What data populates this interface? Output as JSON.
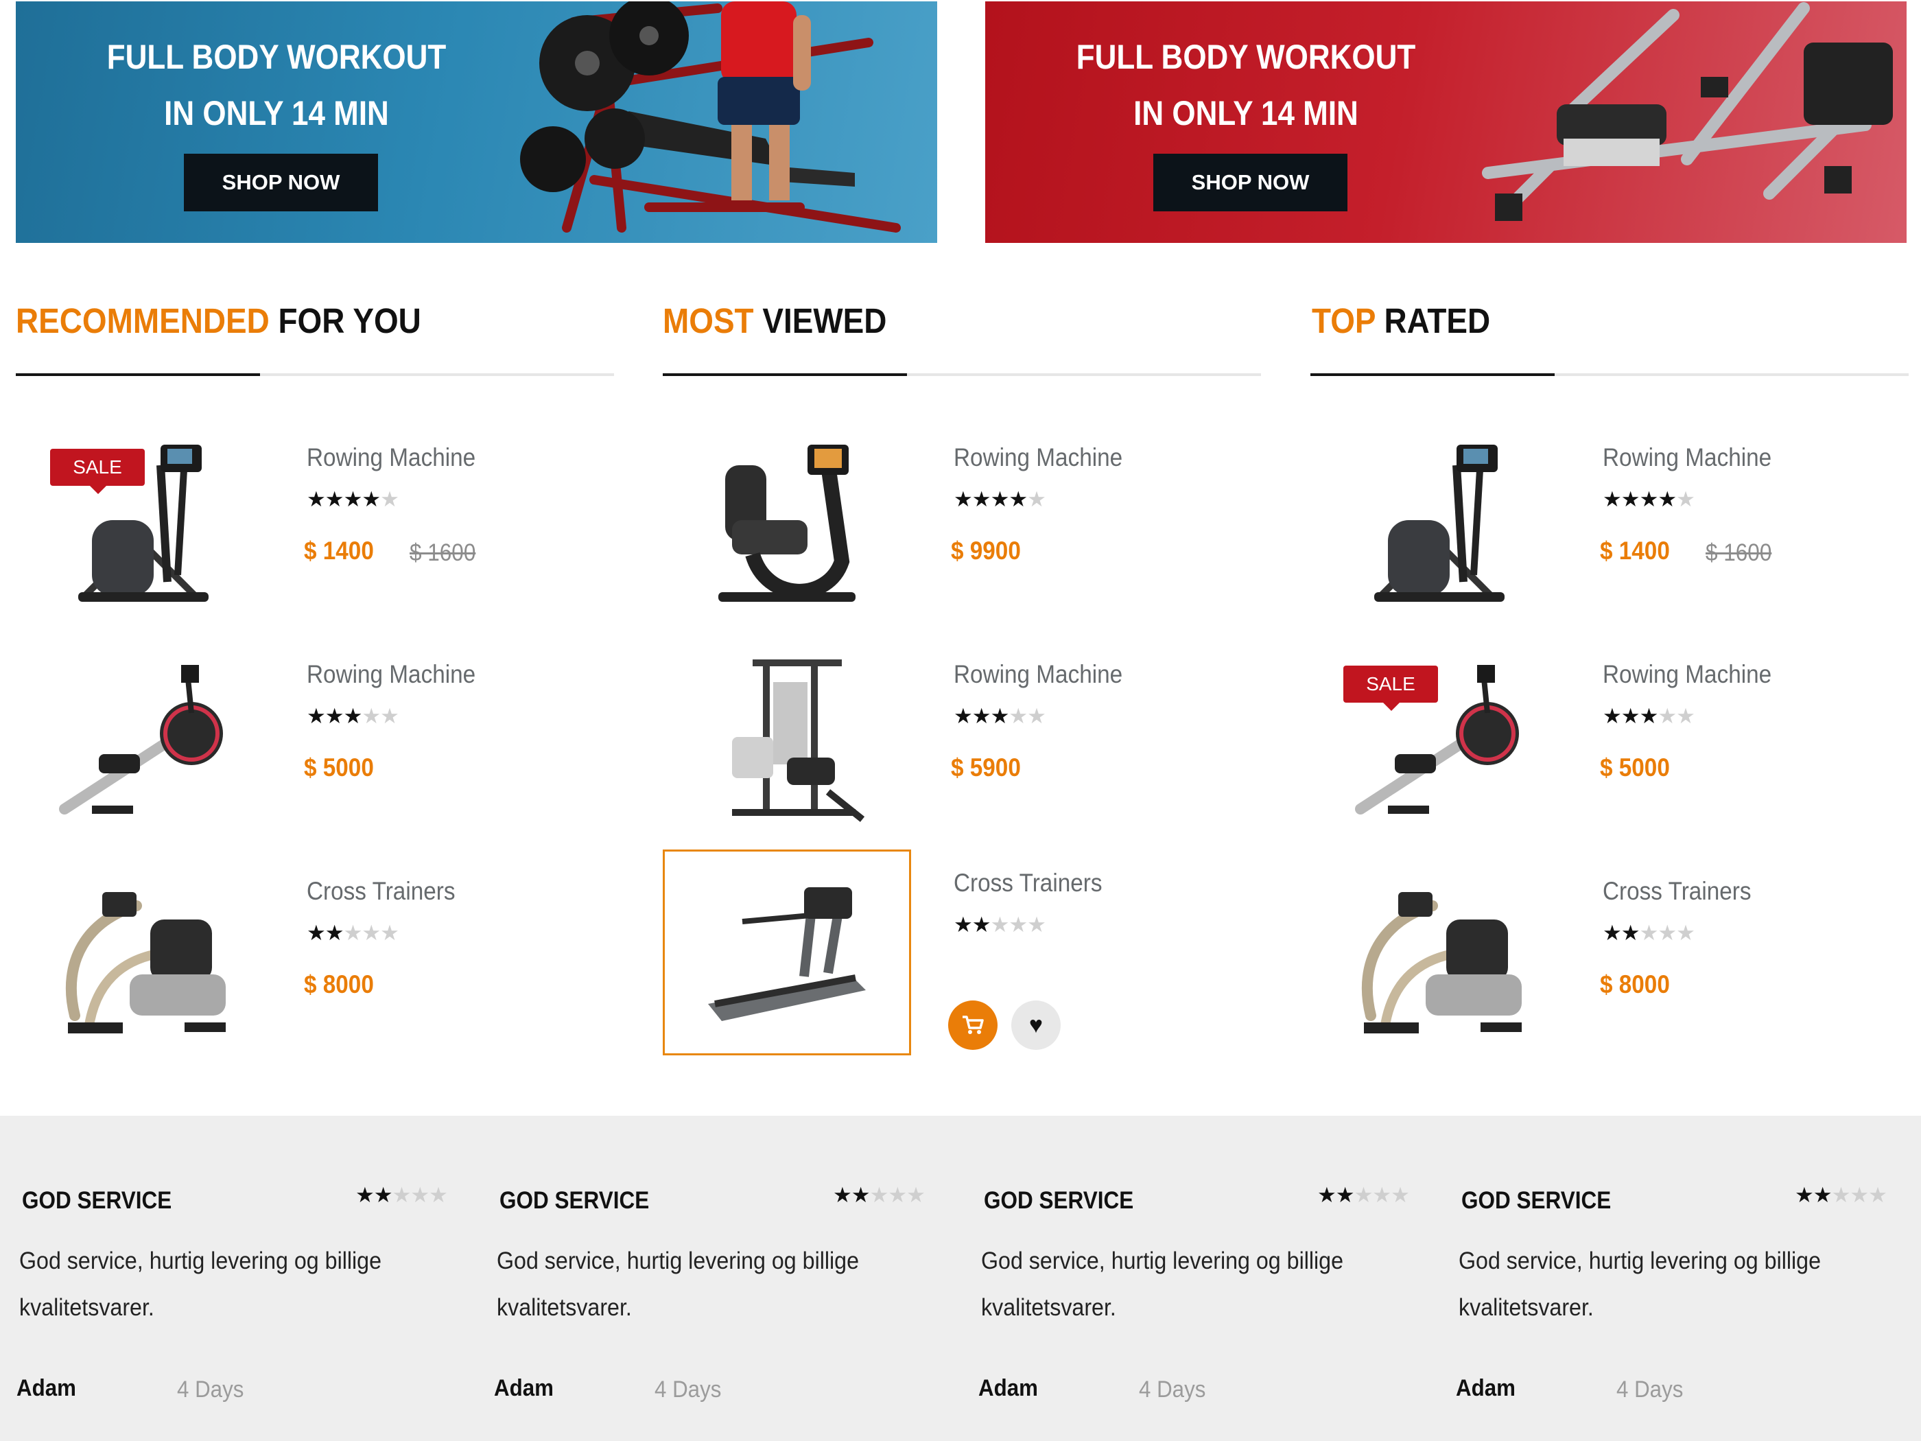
{
  "banners": [
    {
      "title_line1": "FULL BODY WORKOUT",
      "title_line2": "IN ONLY 14 MIN",
      "button": "SHOP NOW",
      "color": "#2b87b3"
    },
    {
      "title_line1": "FULL BODY WORKOUT",
      "title_line2": "IN ONLY 14 MIN",
      "button": "SHOP NOW",
      "color": "#c41f2b"
    }
  ],
  "accent_color": "#ea7d08",
  "columns": [
    {
      "heading_accent": "RECOMMENDED",
      "heading_rest": "FOR YOU",
      "items": [
        {
          "name": "Rowing Machine",
          "rating": 4,
          "price": "$ 1400",
          "old_price": "$ 1600",
          "badge": "SALE",
          "image": "elliptical-icon"
        },
        {
          "name": "Rowing Machine",
          "rating": 3,
          "price": "$ 5000",
          "old_price": "",
          "badge": "",
          "image": "rower-icon"
        },
        {
          "name": "Cross Trainers",
          "rating": 2,
          "price": "$ 8000",
          "old_price": "",
          "badge": "",
          "image": "stepper-icon"
        }
      ]
    },
    {
      "heading_accent": "MOST",
      "heading_rest": "VIEWED",
      "items": [
        {
          "name": "Rowing Machine",
          "rating": 4,
          "price": "$ 9900",
          "old_price": "",
          "badge": "",
          "image": "recumbent-bike-icon"
        },
        {
          "name": "Rowing Machine",
          "rating": 3,
          "price": "$ 5900",
          "old_price": "",
          "badge": "",
          "image": "home-gym-icon"
        },
        {
          "name": "Cross Trainers",
          "rating": 2,
          "price": "",
          "old_price": "",
          "badge": "",
          "image": "treadmill-icon",
          "hovered": true
        }
      ]
    },
    {
      "heading_accent": "TOP",
      "heading_rest": "RATED",
      "items": [
        {
          "name": "Rowing Machine",
          "rating": 4,
          "price": "$ 1400",
          "old_price": "$ 1600",
          "badge": "",
          "image": "elliptical-icon"
        },
        {
          "name": "Rowing Machine",
          "rating": 3,
          "price": "$ 5000",
          "old_price": "",
          "badge": "SALE",
          "image": "rower-icon"
        },
        {
          "name": "Cross Trainers",
          "rating": 2,
          "price": "$ 8000",
          "old_price": "",
          "badge": "",
          "image": "stepper-icon"
        }
      ]
    }
  ],
  "reviews": [
    {
      "title": "GOD SERVICE",
      "rating": 2,
      "text": "God service, hurtig levering og billige kvalitetsvarer.",
      "author": "Adam",
      "time": "4 Days"
    },
    {
      "title": "GOD SERVICE",
      "rating": 2,
      "text": "God service, hurtig levering og billige kvalitetsvarer.",
      "author": "Adam",
      "time": "4 Days"
    },
    {
      "title": "GOD SERVICE",
      "rating": 2,
      "text": "God service, hurtig levering og billige kvalitetsvarer.",
      "author": "Adam",
      "time": "4 Days"
    },
    {
      "title": "GOD SERVICE",
      "rating": 2,
      "text": "God service, hurtig levering og billige kvalitetsvarer.",
      "author": "Adam",
      "time": "4 Days"
    }
  ]
}
